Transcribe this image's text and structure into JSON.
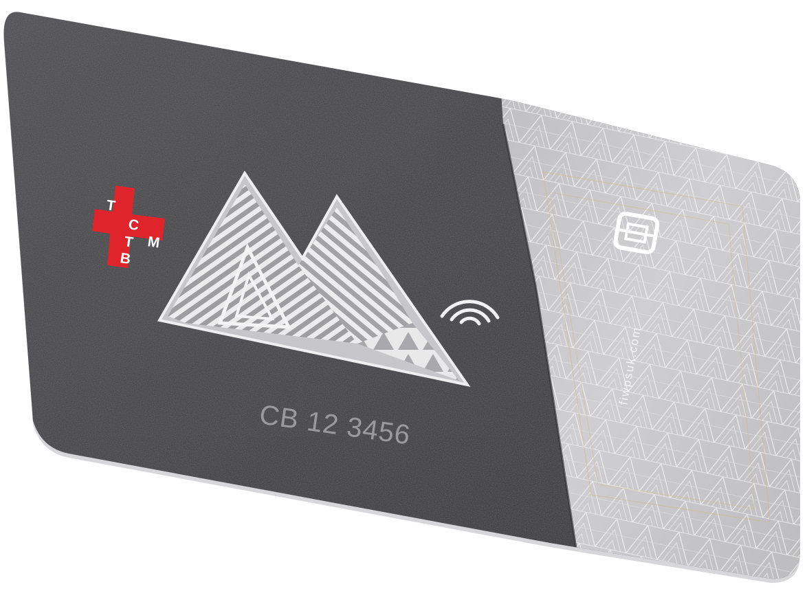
{
  "card": {
    "number": "CB 12 3456",
    "website": "­­fiwpsuk.com",
    "logo": {
      "letters": [
        "T",
        "B",
        "T",
        "C",
        "M"
      ],
      "color": "#e0242b"
    },
    "colors": {
      "dark_face": "#3f3f41",
      "silver_face": "#c9c9cb",
      "engraving": "#e9e9ea"
    },
    "icons": [
      "mountain-logo-icon",
      "contactless-icon",
      "chip-icon",
      "swiss-cross-icon"
    ]
  }
}
